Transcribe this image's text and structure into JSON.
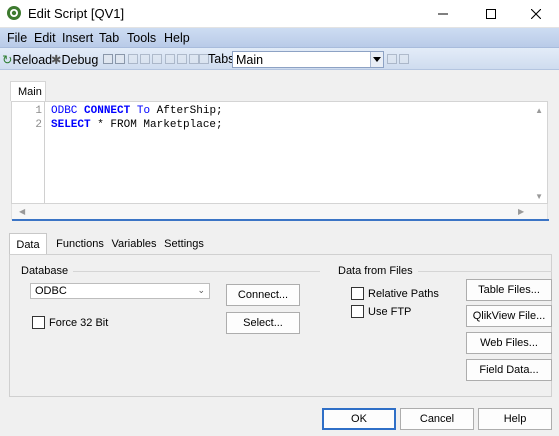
{
  "window": {
    "title": "Edit Script [QV1]"
  },
  "menu": [
    "File",
    "Edit",
    "Insert",
    "Tab",
    "Tools",
    "Help"
  ],
  "toolbar": {
    "reload": "Reload",
    "debug": "Debug",
    "tabs_label": "Tabs",
    "tab_selected": "Main"
  },
  "script_tab": {
    "label": "Main"
  },
  "editor": {
    "lines": [
      {
        "num": "1",
        "kw1": "ODBC",
        "kw2": "CONNECT",
        "kw3": "To",
        "rest": " AfterShip;"
      },
      {
        "num": "2",
        "kw1": "SELECT",
        "rest": " * FROM Marketplace;"
      }
    ]
  },
  "lower_tabs": [
    "Data",
    "Functions",
    "Variables",
    "Settings"
  ],
  "database": {
    "group_label": "Database",
    "driver": "ODBC",
    "connect_button": "Connect...",
    "select_button": "Select...",
    "force32": "Force 32 Bit"
  },
  "files": {
    "group_label": "Data from Files",
    "relative_paths": "Relative Paths",
    "use_ftp": "Use FTP",
    "table_files": "Table Files...",
    "qlikview_file": "QlikView File...",
    "web_files": "Web Files...",
    "field_data": "Field Data..."
  },
  "dialog": {
    "ok": "OK",
    "cancel": "Cancel",
    "help": "Help"
  }
}
